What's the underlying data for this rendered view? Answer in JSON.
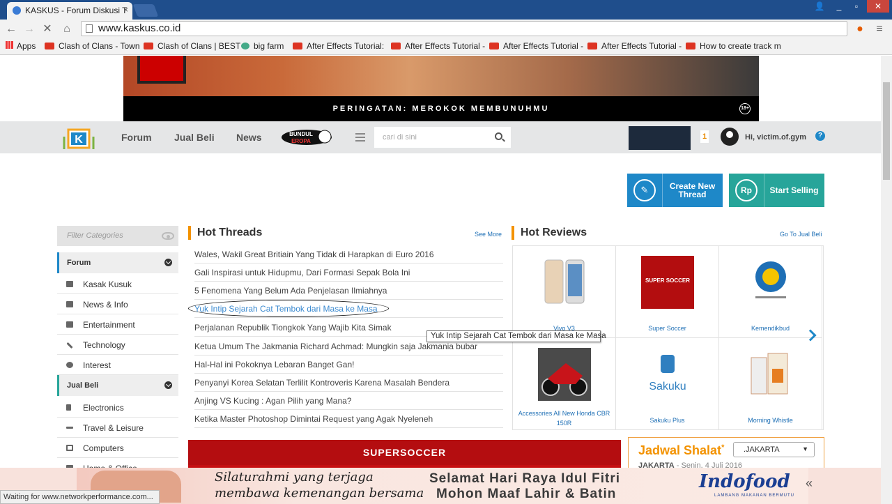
{
  "browser": {
    "tab_title": "KASKUS - Forum Diskusi T",
    "tab_close": "×",
    "url": "www.kaskus.co.id",
    "bookmarks": [
      {
        "label": "Apps"
      },
      {
        "label": "Clash of Clans - Town"
      },
      {
        "label": "Clash of Clans | BEST"
      },
      {
        "label": "big farm"
      },
      {
        "label": "After Effects Tutorial:"
      },
      {
        "label": "After Effects Tutorial -"
      },
      {
        "label": "After Effects Tutorial -"
      },
      {
        "label": "After Effects Tutorial -"
      },
      {
        "label": "How to create track m"
      }
    ],
    "status_text": "Waiting for www.networkperformance.com..."
  },
  "banner_top": {
    "warning": "PERINGATAN: MEROKOK MEMBUNUHMU",
    "age_badge": "18+"
  },
  "header": {
    "nav": [
      "Forum",
      "Jual Beli",
      "News"
    ],
    "bundul_label": "BUNDUL EROPA",
    "search_placeholder": "cari di sini",
    "notification_count": "1",
    "greeting": "Hi, victim.of.gym",
    "help": "?"
  },
  "actions": {
    "create_thread": "Create New Thread",
    "start_selling": "Start Selling",
    "create_icon": "✎",
    "sell_icon": "Rp"
  },
  "sidebar": {
    "filter_placeholder": "Filter Categories",
    "forum_head": "Forum",
    "forum_items": [
      "Kasak Kusuk",
      "News & Info",
      "Entertainment",
      "Technology",
      "Interest"
    ],
    "jualbeli_head": "Jual Beli",
    "jualbeli_items": [
      "Electronics",
      "Travel & Leisure",
      "Computers",
      "Home & Office"
    ]
  },
  "hot_threads": {
    "title": "Hot Threads",
    "see_more": "See More",
    "items": [
      "Wales, Wakil Great Britiain Yang Tidak di Harapkan di Euro 2016",
      "Gali Inspirasi untuk Hidupmu, Dari Formasi Sepak Bola Ini",
      "5 Fenomena Yang Belum Ada Penjelasan Ilmiahnya",
      "Yuk Intip Sejarah Cat Tembok dari Masa ke Masa",
      "Perjalanan Republik Tiongkok Yang Wajib Kita Simak",
      "Ketua Umum The Jakmania Richard Achmad: Mungkin saja Jakmania bubar",
      "Hal-Hal ini Pokoknya Lebaran Banget Gan!",
      "Penyanyi Korea Selatan Terlilit Kontroveris Karena Masalah Bendera",
      "Anjing VS Kucing : Agan Pilih yang Mana?",
      "Ketika Master Photoshop Dimintai Request yang Agak Nyeleneh"
    ],
    "tooltip": "Yuk Intip Sejarah Cat Tembok dari Masa ke Masa"
  },
  "hot_reviews": {
    "title": "Hot Reviews",
    "link": "Go To Jual Beli",
    "items": [
      {
        "caption": "Vivo V3"
      },
      {
        "caption": "Super Soccer"
      },
      {
        "caption": "Kemendikbud"
      },
      {
        "caption": "Accessories All New Honda CBR 150R"
      },
      {
        "caption": "Sakuku Plus"
      },
      {
        "caption": "Morning Whistle"
      }
    ],
    "super_soccer_logo": "SUPER SOCCER",
    "sakuku_logo": "Sakuku"
  },
  "soccer_ad": {
    "label": "SUPERSOCCER"
  },
  "jadwal": {
    "title": "Jadwal Shalat",
    "asterisk": "*",
    "city": ".JAKARTA",
    "caret": "▼",
    "location": "JAKARTA",
    "date": "Senin, 4 Juli 2016"
  },
  "bottom_ad": {
    "line1": "Silaturahmi yang terjaga",
    "line2": "membawa kemenangan bersama",
    "greet1": "Selamat Hari Raya Idul Fitri",
    "greet2": "Mohon Maaf Lahir & Batin",
    "brand": "Indofood",
    "tagline": "LAMBANG MAKANAN BERMUTU",
    "collapse": "«"
  }
}
